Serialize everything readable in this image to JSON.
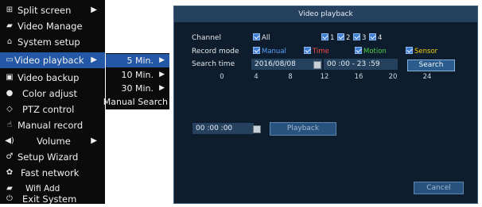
{
  "menu": {
    "items": [
      {
        "icon": "⊞",
        "icon_name": "grid-icon",
        "label": "Split screen",
        "arrow": "▶"
      },
      {
        "icon": "▰",
        "icon_name": "camera-icon",
        "label": "Video Manage",
        "arrow": ""
      },
      {
        "icon": "⌂",
        "icon_name": "home-icon",
        "label": "System setup",
        "arrow": ""
      },
      {
        "icon": "▭",
        "icon_name": "film-icon",
        "label": "Video playback",
        "arrow": "▶"
      },
      {
        "icon": "▣",
        "icon_name": "save-icon",
        "label": "Video backup",
        "arrow": ""
      },
      {
        "icon": "●",
        "icon_name": "palette-icon",
        "label": "Color adjust",
        "arrow": ""
      },
      {
        "icon": "◇",
        "icon_name": "ptz-icon",
        "label": "PTZ control",
        "arrow": ""
      },
      {
        "icon": "☝",
        "icon_name": "hand-icon",
        "label": "Manual record",
        "arrow": ""
      },
      {
        "icon": "◀)",
        "icon_name": "speaker-icon",
        "label": "Volume",
        "arrow": "▶"
      },
      {
        "icon": "♂",
        "icon_name": "wizard-icon",
        "label": "Setup Wizard",
        "arrow": ""
      },
      {
        "icon": "✿",
        "icon_name": "network-icon",
        "label": "Fast network",
        "arrow": ""
      },
      {
        "icon": "▰",
        "icon_name": "wifi-icon",
        "label": "Wifi Add",
        "arrow": ""
      },
      {
        "icon": "⏻",
        "icon_name": "power-icon",
        "label": "Exit System",
        "arrow": ""
      }
    ],
    "selected": "Video playback"
  },
  "submenu": {
    "items": [
      {
        "label": "5 Min.",
        "arrow": "▶"
      },
      {
        "label": "10 Min.",
        "arrow": "▶"
      },
      {
        "label": "30 Min.",
        "arrow": "▶"
      },
      {
        "label": "Manual Search",
        "arrow": ""
      }
    ],
    "selected": "5 Min."
  },
  "window": {
    "title": "Video playback",
    "channel_label": "Channel",
    "channel_all": "All",
    "channels": [
      "1",
      "2",
      "3",
      "4"
    ],
    "record_mode_label": "Record mode",
    "modes": [
      {
        "label": "Manual",
        "color": "#5aa0ff"
      },
      {
        "label": "Time",
        "color": "#ff4a4a"
      },
      {
        "label": "Motion",
        "color": "#4ad04a"
      },
      {
        "label": "Sensor",
        "color": "#f5d000"
      }
    ],
    "search_time_label": "Search time",
    "date": "2016/08/08",
    "time_range": "00 :00 - 23 :59",
    "search_button": "Search",
    "timeline_ticks": [
      "0",
      "4",
      "8",
      "12",
      "16",
      "20",
      "24"
    ],
    "playback_time": "00 :00 :00",
    "playback_button": "Playback",
    "cancel_button": "Cancel"
  }
}
